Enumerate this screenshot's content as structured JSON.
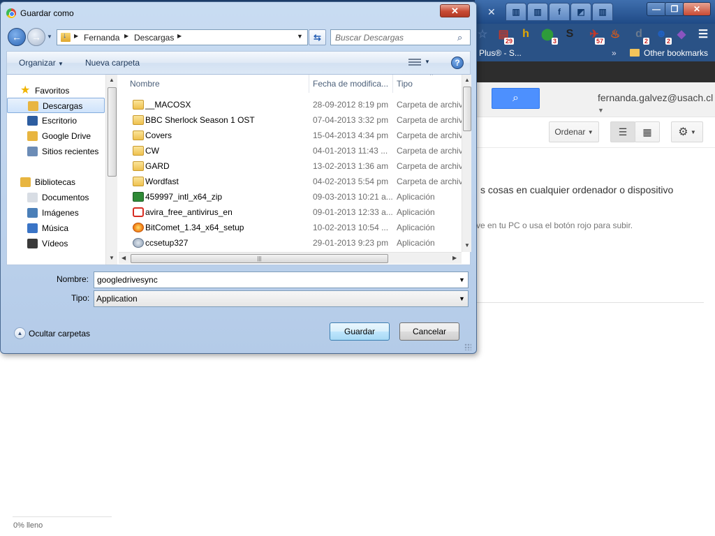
{
  "browser": {
    "bookmarks_partial": "Plus® - S...",
    "bookmarks_chevron": "»",
    "other_bookmarks": "Other bookmarks",
    "extensions": [
      {
        "icon": "star-outline-icon",
        "glyph": "☆",
        "color": "#4a6ea0"
      },
      {
        "icon": "calendar-ext-icon",
        "glyph": "▤",
        "color": "#c0392b",
        "badge": "29"
      },
      {
        "icon": "hola-h-icon",
        "glyph": "h",
        "color": "#e5a900"
      },
      {
        "icon": "green-circle-ext-icon",
        "glyph": "⬤",
        "color": "#2e9b3a",
        "badge": "3"
      },
      {
        "icon": "s-ext-icon",
        "glyph": "S",
        "color": "#222222"
      },
      {
        "icon": "plane-ext-icon",
        "glyph": "✈",
        "color": "#c0392b",
        "badge": "57"
      },
      {
        "icon": "fire-ext-icon",
        "glyph": "♨",
        "color": "#e35a12"
      },
      {
        "icon": "d-ext-icon",
        "glyph": "d",
        "color": "#6a7a8e",
        "badge": "2"
      },
      {
        "icon": "people-ext-icon",
        "glyph": "☻",
        "color": "#1f5fbf",
        "badge": "2"
      },
      {
        "icon": "diamond-ext-icon",
        "glyph": "◆",
        "color": "#8a54c0"
      },
      {
        "icon": "menu-icon",
        "glyph": "☰",
        "color": "#ffffff"
      }
    ],
    "tabs": [
      {
        "icon": "bookmark-tab-icon",
        "glyph": "▥"
      },
      {
        "icon": "bookmark-tab-icon",
        "glyph": "▥"
      },
      {
        "icon": "facebook-tab-icon",
        "glyph": "f"
      },
      {
        "icon": "image-tab-icon",
        "glyph": "◩"
      },
      {
        "icon": "bookmark-tab-icon",
        "glyph": "▥"
      }
    ],
    "tab_close": "✕",
    "window_buttons": {
      "minimize": "—",
      "maximize": "❐",
      "close": "✕"
    }
  },
  "drive": {
    "search_glyph": "🔍",
    "user_email": "fernanda.galvez@usach.cl",
    "sort_label": "Ordenar",
    "msg_line1": "s cosas en cualquier ordenador o dispositivo",
    "msg_line2": "ve en tu PC o usa el botón rojo para subir.",
    "storage": "0% lleno"
  },
  "dialog": {
    "title": "Guardar como",
    "close_glyph": "✕",
    "breadcrumb": [
      "Fernanda",
      "Descargas"
    ],
    "search_placeholder": "Buscar Descargas",
    "organize_label": "Organizar",
    "new_folder_label": "Nueva carpeta",
    "help_glyph": "?",
    "nav_items": [
      {
        "label": "Favoritos",
        "icon": "star-icon",
        "color": "#f0b400",
        "group": true
      },
      {
        "label": "Descargas",
        "icon": "downloads-folder-icon",
        "color": "#e8b540",
        "selected": true
      },
      {
        "label": "Escritorio",
        "icon": "desktop-icon",
        "color": "#2d5da0"
      },
      {
        "label": "Google Drive",
        "icon": "google-drive-folder-icon",
        "color": "#e8b540"
      },
      {
        "label": "Sitios recientes",
        "icon": "recent-places-icon",
        "color": "#6c8cb6"
      },
      {
        "label": "Bibliotecas",
        "icon": "libraries-icon",
        "color": "#e8b540",
        "group": true
      },
      {
        "label": "Documentos",
        "icon": "documents-icon",
        "color": "#d8dde4"
      },
      {
        "label": "Imágenes",
        "icon": "pictures-icon",
        "color": "#4b7fb8"
      },
      {
        "label": "Música",
        "icon": "music-icon",
        "color": "#3a74c6"
      },
      {
        "label": "Vídeos",
        "icon": "videos-icon",
        "color": "#3a3a3a"
      }
    ],
    "columns": {
      "name": "Nombre",
      "date": "Fecha de modifica...",
      "type": "Tipo"
    },
    "files": [
      {
        "name": "__MACOSX",
        "date": "28-09-2012 8:19 pm",
        "type": "Carpeta de archivos",
        "kind": "folder"
      },
      {
        "name": "BBC Sherlock Season 1 OST",
        "date": "07-04-2013 3:32 pm",
        "type": "Carpeta de archivos",
        "kind": "folder"
      },
      {
        "name": "Covers",
        "date": "15-04-2013 4:34 pm",
        "type": "Carpeta de archivos",
        "kind": "folder"
      },
      {
        "name": "CW",
        "date": "04-01-2013 11:43 ...",
        "type": "Carpeta de archivos",
        "kind": "folder"
      },
      {
        "name": "GARD",
        "date": "13-02-2013 1:36 am",
        "type": "Carpeta de archivos",
        "kind": "folder"
      },
      {
        "name": "Wordfast",
        "date": "04-02-2013 5:54 pm",
        "type": "Carpeta de archivos",
        "kind": "folder"
      },
      {
        "name": "459997_intl_x64_zip",
        "date": "09-03-2013 10:21 a...",
        "type": "Aplicación",
        "kind": "app-green"
      },
      {
        "name": "avira_free_antivirus_en",
        "date": "09-01-2013 12:33 a...",
        "type": "Aplicación",
        "kind": "app-red"
      },
      {
        "name": "BitComet_1.34_x64_setup",
        "date": "10-02-2013 10:54 ...",
        "type": "Aplicación",
        "kind": "app-orange"
      },
      {
        "name": "ccsetup327",
        "date": "29-01-2013 9:23 pm",
        "type": "Aplicación",
        "kind": "app-gray"
      }
    ],
    "name_label": "Nombre:",
    "name_value": "googledrivesync",
    "type_label": "Tipo:",
    "type_value": "Application",
    "hide_folders_label": "Ocultar carpetas",
    "save_label": "Guardar",
    "cancel_label": "Cancelar",
    "list_scroll_fraction": 0.0
  }
}
